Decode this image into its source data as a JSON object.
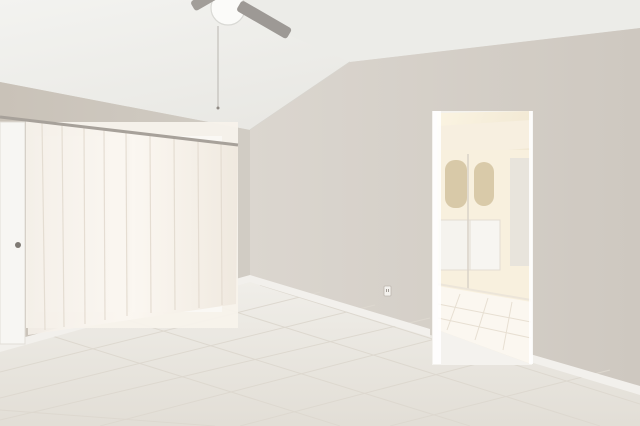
{
  "scene": {
    "kind": "photo",
    "room": "empty-bedroom",
    "features": [
      "vaulted-ceiling",
      "ceiling-fan",
      "sheer-curtains",
      "sliding-glass-door",
      "open-doorway-to-bathroom",
      "tile-floor",
      "baseboard-trim",
      "wall-outlet"
    ],
    "colors": {
      "ceiling": "#efefec",
      "wall_left": "#ccc7bf",
      "wall_right": "#d8d3cc",
      "floor": "#e8e5de",
      "baseboard": "#f2f0ec",
      "curtain": "#f3eee8",
      "bathroom_light": "#f6ead0"
    }
  }
}
